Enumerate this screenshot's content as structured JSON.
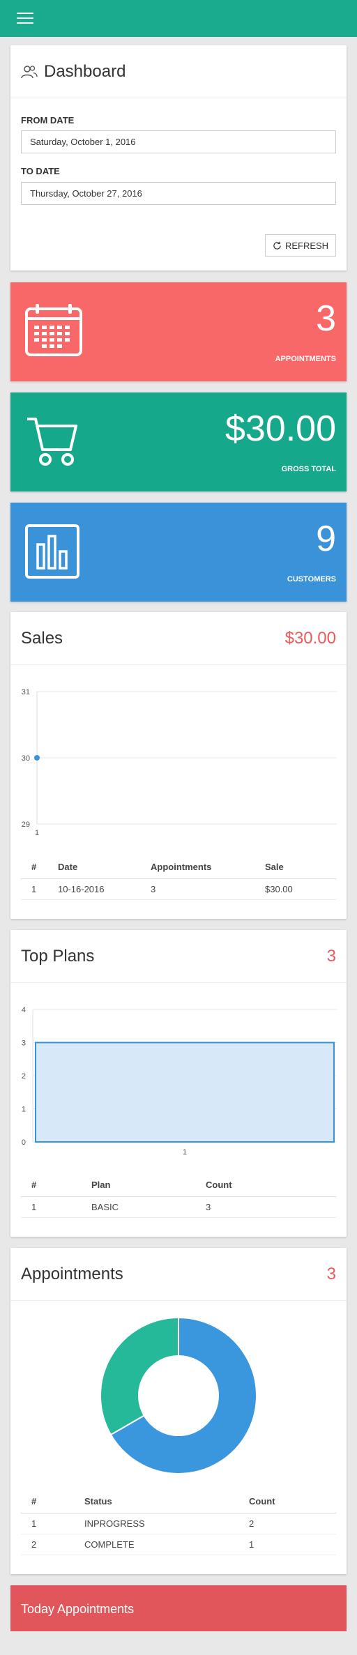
{
  "topbar": {
    "menu_icon": "hamburger-menu-icon",
    "color": "#1aaa8e"
  },
  "dashboard": {
    "title": "Dashboard",
    "icon": "users-icon",
    "from_label": "FROM DATE",
    "from_value": "Saturday, October 1, 2016",
    "to_label": "TO DATE",
    "to_value": "Thursday, October 27, 2016",
    "refresh_label": "REFRESH",
    "refresh_icon": "refresh-icon"
  },
  "stats": [
    {
      "value": "3",
      "label": "APPOINTMENTS",
      "icon": "calendar-icon",
      "color": "#f96868"
    },
    {
      "value": "$30.00",
      "label": "GROSS TOTAL",
      "icon": "cart-icon",
      "color": "#16a88a"
    },
    {
      "value": "9",
      "label": "CUSTOMERS",
      "icon": "bar-chart-icon",
      "color": "#3a93d8"
    }
  ],
  "sales": {
    "title": "Sales",
    "value": "$30.00",
    "table": {
      "headers": [
        "#",
        "Date",
        "Appointments",
        "Sale"
      ],
      "rows": [
        [
          "1",
          "10-16-2016",
          "3",
          "$30.00"
        ]
      ]
    }
  },
  "top_plans": {
    "title": "Top Plans",
    "value": "3",
    "table": {
      "headers": [
        "#",
        "Plan",
        "Count"
      ],
      "rows": [
        [
          "1",
          "BASIC",
          "3"
        ]
      ]
    }
  },
  "appointments": {
    "title": "Appointments",
    "value": "3",
    "table": {
      "headers": [
        "#",
        "Status",
        "Count"
      ],
      "rows": [
        [
          "1",
          "INPROGRESS",
          "2"
        ],
        [
          "2",
          "COMPLETE",
          "1"
        ]
      ]
    }
  },
  "today": {
    "title": "Today Appointments",
    "color": "#e0565a"
  },
  "chart_data": [
    {
      "type": "line",
      "x": [
        "1"
      ],
      "series": [
        {
          "values": [
            30
          ]
        }
      ],
      "ylim": [
        29,
        31
      ],
      "yticks": [
        "29",
        "30",
        "31"
      ],
      "grid": true,
      "color": "#3a93d8"
    },
    {
      "type": "area",
      "x": [
        "1"
      ],
      "series": [
        {
          "values": [
            3
          ]
        }
      ],
      "ylim": [
        0,
        4
      ],
      "yticks": [
        "0",
        "1",
        "2",
        "3",
        "4"
      ],
      "grid": true,
      "color": "#3a93d8"
    },
    {
      "type": "pie",
      "categories": [
        "INPROGRESS",
        "COMPLETE"
      ],
      "values": [
        2,
        1
      ],
      "colors": [
        "#3a96dd",
        "#26b999"
      ],
      "donut": true
    }
  ]
}
